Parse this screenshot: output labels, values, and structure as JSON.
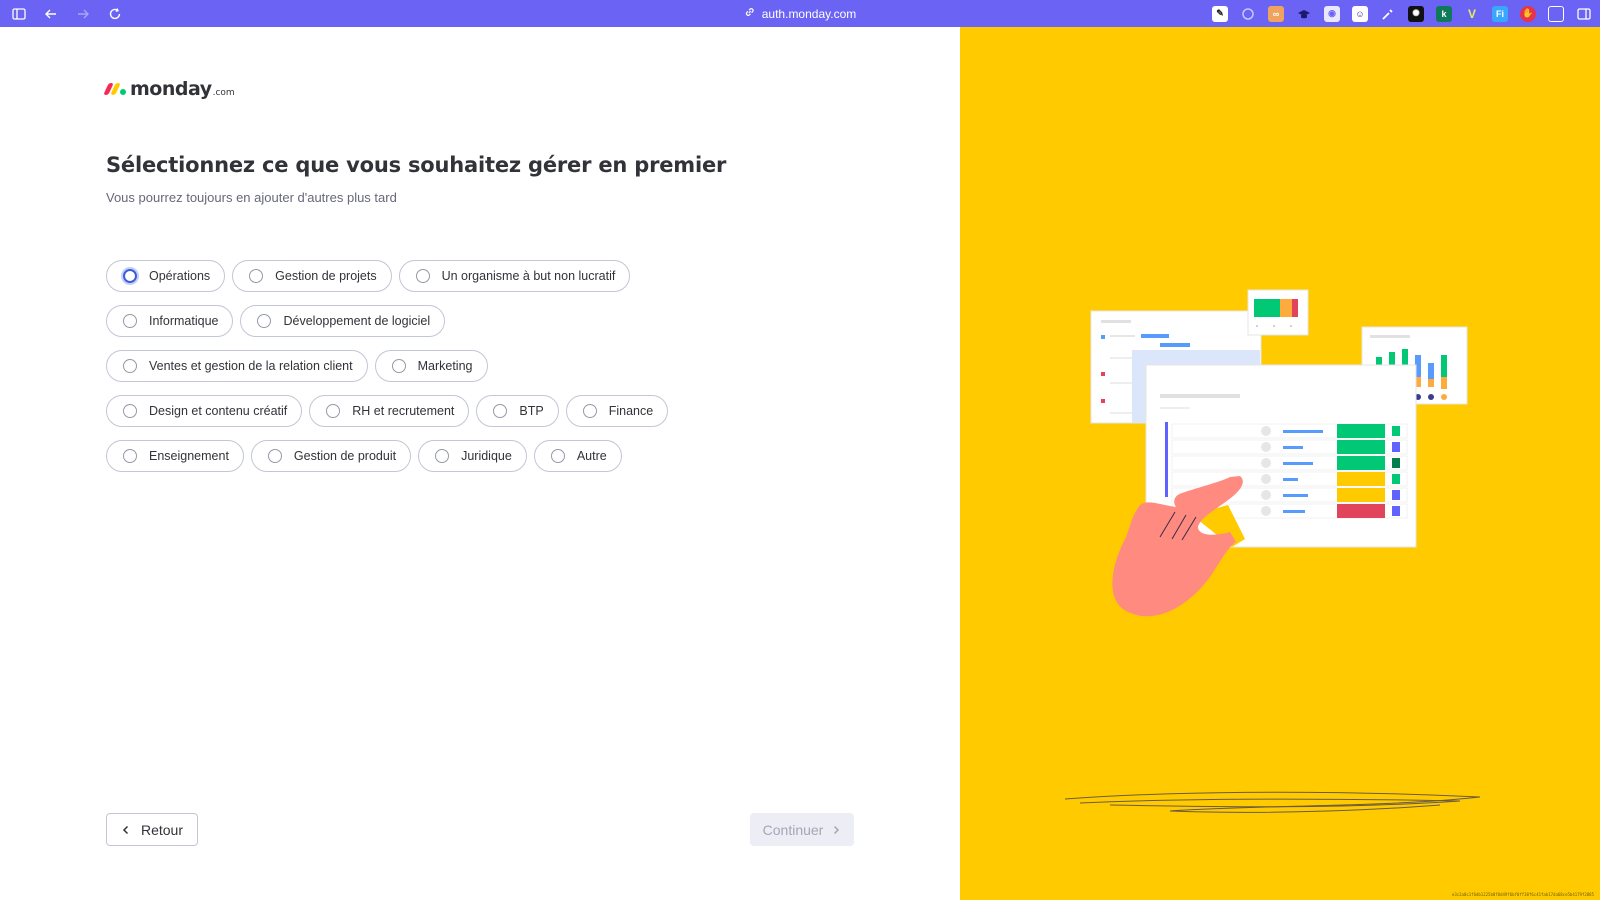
{
  "browser": {
    "url": "auth.monday.com"
  },
  "logo": {
    "brand": "monday",
    "suffix": ".com"
  },
  "page": {
    "title": "Sélectionnez ce que vous souhaitez gérer en premier",
    "subtitle": "Vous pourrez toujours en ajouter d'autres plus tard"
  },
  "options": {
    "rows": [
      [
        "Opérations",
        "Gestion de projets",
        "Un organisme à but non lucratif"
      ],
      [
        "Informatique",
        "Développement de logiciel"
      ],
      [
        "Ventes et gestion de la relation client",
        "Marketing"
      ],
      [
        "Design et contenu créatif",
        "RH et recrutement",
        "BTP",
        "Finance"
      ],
      [
        "Enseignement",
        "Gestion de produit",
        "Juridique",
        "Autre"
      ]
    ]
  },
  "buttons": {
    "back": "Retour",
    "continue": "Continuer"
  },
  "footer": {
    "id": "e3c2a0c1f6db1225b8f8d49f6bf0ff38f6c41fab17da68ce5b4179f2885"
  },
  "colors": {
    "browser_bar": "#6a63f4",
    "right_panel": "#ffcb00",
    "logo_red": "#f62b54",
    "logo_yellow": "#ffcb00",
    "logo_green": "#00ca72"
  }
}
